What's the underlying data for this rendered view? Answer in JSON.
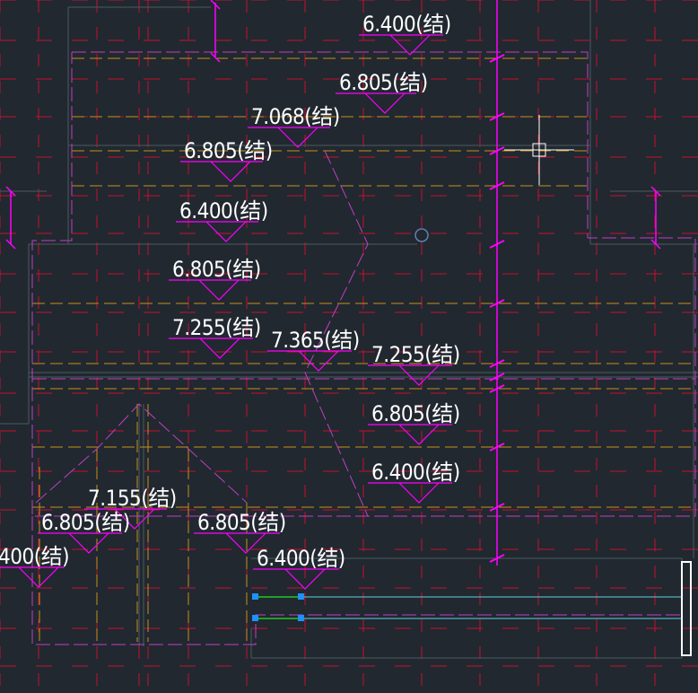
{
  "colors": {
    "background": "#212830",
    "outline": "#4a5a60",
    "red_grid": "#c8102e",
    "magenta": "#ff00ff",
    "orange_dash": "#c8901a",
    "cyan": "#5fd0e0",
    "green": "#1fc81f",
    "blue_grip": "#1e90ff",
    "text": "#ffffff",
    "cursor": "#ffffff"
  },
  "elevation_tags": [
    {
      "value": "6.400",
      "suffix": "(结)"
    },
    {
      "value": "6.805",
      "suffix": "(结)"
    },
    {
      "value": "7.068",
      "suffix": "(结)"
    },
    {
      "value": "6.805",
      "suffix": "(结)"
    },
    {
      "value": "6.400",
      "suffix": "(结)"
    },
    {
      "value": "6.805",
      "suffix": "(结)"
    },
    {
      "value": "7.255",
      "suffix": "(结)"
    },
    {
      "value": "7.365",
      "suffix": "(结)"
    },
    {
      "value": "7.255",
      "suffix": "(结)"
    },
    {
      "value": "6.805",
      "suffix": "(结)"
    },
    {
      "value": "6.400",
      "suffix": "(结)"
    },
    {
      "value": "7.155",
      "suffix": "(结)"
    },
    {
      "value": "6.805",
      "suffix": "(结)"
    },
    {
      "value": "6.805",
      "suffix": "(结)"
    },
    {
      "value": "400",
      "suffix": "(结)"
    },
    {
      "value": "6.400",
      "suffix": "(结)"
    }
  ],
  "cursor": {
    "type": "crosshair-pickbox"
  }
}
